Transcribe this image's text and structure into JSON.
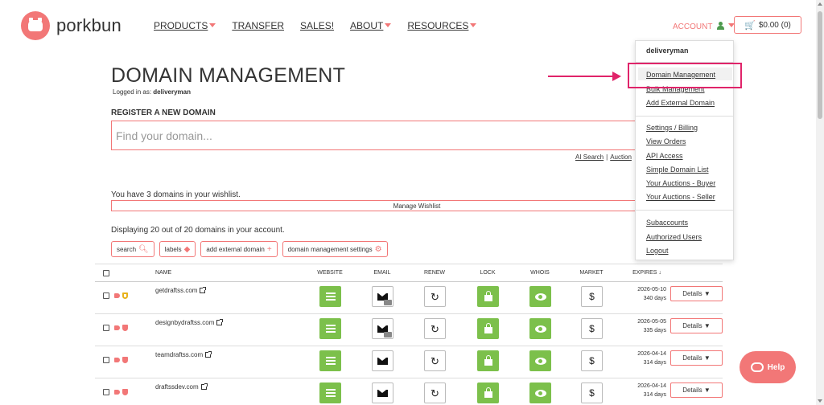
{
  "brand": {
    "name": "porkbun",
    "accent": "#f27777"
  },
  "nav": [
    {
      "label": "PRODUCTS",
      "caret": true
    },
    {
      "label": "TRANSFER",
      "caret": false
    },
    {
      "label": "SALES!",
      "caret": false
    },
    {
      "label": "ABOUT",
      "caret": true
    },
    {
      "label": "RESOURCES",
      "caret": true
    }
  ],
  "header": {
    "account_label": "ACCOUNT",
    "cart_label": "$0.00 (0)"
  },
  "page": {
    "title": "DOMAIN MANAGEMENT",
    "logged_in_prefix": "Logged in as:",
    "username": "deliveryman",
    "register_label": "REGISTER A NEW DOMAIN",
    "search_placeholder": "Find your domain...",
    "search_links": [
      "AI Search",
      "Auction"
    ],
    "wishlist_text": "You have 3 domains in your wishlist.",
    "wishlist_button": "Manage Wishlist",
    "displaying_text": "Displaying 20 out of 20 domains in your account."
  },
  "toolbar": {
    "search": "search",
    "labels": "labels",
    "add_external": "add external domain",
    "settings": "domain management settings"
  },
  "table": {
    "headers": {
      "name": "NAME",
      "website": "WEBSITE",
      "email": "EMAIL",
      "renew": "RENEW",
      "lock": "LOCK",
      "whois": "WHOIS",
      "market": "MARKET",
      "expires": "EXPIRES"
    },
    "details_label": "Details ▼",
    "rows": [
      {
        "domain": "getdraftss.com",
        "expires": "2026-05-10",
        "days": "340 days",
        "email_badge": true,
        "shield": "gold"
      },
      {
        "domain": "designbydraftss.com",
        "expires": "2026-05-05",
        "days": "335 days",
        "email_badge": true,
        "shield": "red"
      },
      {
        "domain": "teamdraftss.com",
        "expires": "2026-04-14",
        "days": "314 days",
        "email_badge": false,
        "shield": "red"
      },
      {
        "domain": "draftssdev.com",
        "expires": "2026-04-14",
        "days": "314 days",
        "email_badge": false,
        "shield": "red"
      }
    ]
  },
  "account_menu": {
    "username": "deliveryman",
    "group1": [
      "Domain Management",
      "Bulk Management",
      "Add External Domain"
    ],
    "group2": [
      "Settings / Billing",
      "View Orders",
      "API Access",
      "Simple Domain List",
      "Your Auctions - Buyer",
      "Your Auctions - Seller"
    ],
    "group3": [
      "Subaccounts",
      "Authorized Users",
      "Logout"
    ]
  },
  "help": {
    "label": "Help"
  },
  "annotation": {
    "color": "#e0246a"
  }
}
